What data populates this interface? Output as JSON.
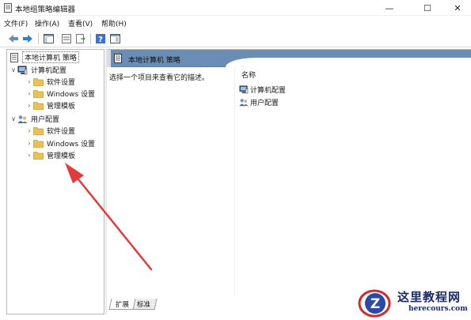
{
  "window": {
    "title": "本地组策略编辑器",
    "minimize_glyph": "—",
    "maximize_glyph": "☐",
    "close_glyph": "✕"
  },
  "menu": [
    {
      "label": "文件(F)"
    },
    {
      "label": "操作(A)"
    },
    {
      "label": "查看(V)"
    },
    {
      "label": "帮助(H)"
    }
  ],
  "toolbar": {
    "icons": [
      "back-arrow-icon",
      "forward-arrow-icon",
      "show-hide-console-tree-icon",
      "properties-icon",
      "export-list-icon",
      "help-icon",
      "extended-view-icon"
    ]
  },
  "tree": {
    "root": {
      "label": "本地计算机 策略",
      "icon": "policy-document-icon"
    },
    "computer_config": {
      "label": "计算机配置",
      "icon": "computer-icon",
      "children": [
        {
          "label": "软件设置",
          "icon": "folder-icon"
        },
        {
          "label": "Windows 设置",
          "icon": "folder-icon"
        },
        {
          "label": "管理模板",
          "icon": "folder-icon"
        }
      ]
    },
    "user_config": {
      "label": "用户配置",
      "icon": "users-icon",
      "children": [
        {
          "label": "软件设置",
          "icon": "folder-icon"
        },
        {
          "label": "Windows 设置",
          "icon": "folder-icon"
        },
        {
          "label": "管理模板",
          "icon": "folder-icon"
        }
      ]
    }
  },
  "right_pane": {
    "header_title": "本地计算机 策略",
    "description": "选择一个项目来查看它的描述。",
    "column_header": "名称",
    "items": [
      {
        "label": "计算机配置",
        "icon": "computer-icon"
      },
      {
        "label": "用户配置",
        "icon": "users-icon"
      }
    ]
  },
  "tabs": [
    {
      "label": "扩展",
      "active": true
    },
    {
      "label": "标准",
      "active": false
    }
  ],
  "watermark": {
    "logo_letter": "Z",
    "name": "这里教程网",
    "domain": "herecours.com"
  },
  "colors": {
    "header_blue": "#6a8db5",
    "folder_yellow": "#e8c15a",
    "annotation_red": "#e23b3b",
    "watermark_navy": "#1b2a6b"
  }
}
